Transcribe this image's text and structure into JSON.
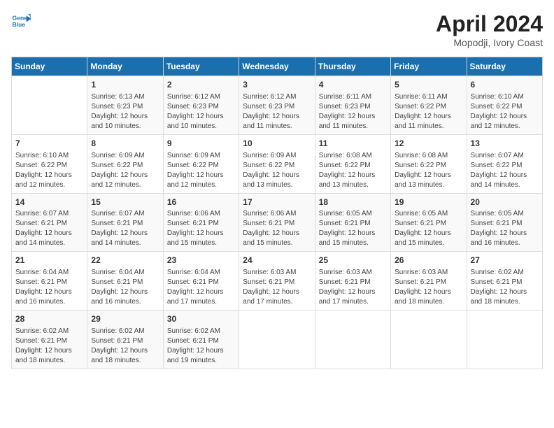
{
  "header": {
    "logo_line1": "General",
    "logo_line2": "Blue",
    "title": "April 2024",
    "subtitle": "Mopodji, Ivory Coast"
  },
  "weekdays": [
    "Sunday",
    "Monday",
    "Tuesday",
    "Wednesday",
    "Thursday",
    "Friday",
    "Saturday"
  ],
  "weeks": [
    [
      {
        "day": "",
        "info": ""
      },
      {
        "day": "1",
        "info": "Sunrise: 6:13 AM\nSunset: 6:23 PM\nDaylight: 12 hours\nand 10 minutes."
      },
      {
        "day": "2",
        "info": "Sunrise: 6:12 AM\nSunset: 6:23 PM\nDaylight: 12 hours\nand 10 minutes."
      },
      {
        "day": "3",
        "info": "Sunrise: 6:12 AM\nSunset: 6:23 PM\nDaylight: 12 hours\nand 11 minutes."
      },
      {
        "day": "4",
        "info": "Sunrise: 6:11 AM\nSunset: 6:23 PM\nDaylight: 12 hours\nand 11 minutes."
      },
      {
        "day": "5",
        "info": "Sunrise: 6:11 AM\nSunset: 6:22 PM\nDaylight: 12 hours\nand 11 minutes."
      },
      {
        "day": "6",
        "info": "Sunrise: 6:10 AM\nSunset: 6:22 PM\nDaylight: 12 hours\nand 12 minutes."
      }
    ],
    [
      {
        "day": "7",
        "info": "Sunrise: 6:10 AM\nSunset: 6:22 PM\nDaylight: 12 hours\nand 12 minutes."
      },
      {
        "day": "8",
        "info": "Sunrise: 6:09 AM\nSunset: 6:22 PM\nDaylight: 12 hours\nand 12 minutes."
      },
      {
        "day": "9",
        "info": "Sunrise: 6:09 AM\nSunset: 6:22 PM\nDaylight: 12 hours\nand 12 minutes."
      },
      {
        "day": "10",
        "info": "Sunrise: 6:09 AM\nSunset: 6:22 PM\nDaylight: 12 hours\nand 13 minutes."
      },
      {
        "day": "11",
        "info": "Sunrise: 6:08 AM\nSunset: 6:22 PM\nDaylight: 12 hours\nand 13 minutes."
      },
      {
        "day": "12",
        "info": "Sunrise: 6:08 AM\nSunset: 6:22 PM\nDaylight: 12 hours\nand 13 minutes."
      },
      {
        "day": "13",
        "info": "Sunrise: 6:07 AM\nSunset: 6:22 PM\nDaylight: 12 hours\nand 14 minutes."
      }
    ],
    [
      {
        "day": "14",
        "info": "Sunrise: 6:07 AM\nSunset: 6:21 PM\nDaylight: 12 hours\nand 14 minutes."
      },
      {
        "day": "15",
        "info": "Sunrise: 6:07 AM\nSunset: 6:21 PM\nDaylight: 12 hours\nand 14 minutes."
      },
      {
        "day": "16",
        "info": "Sunrise: 6:06 AM\nSunset: 6:21 PM\nDaylight: 12 hours\nand 15 minutes."
      },
      {
        "day": "17",
        "info": "Sunrise: 6:06 AM\nSunset: 6:21 PM\nDaylight: 12 hours\nand 15 minutes."
      },
      {
        "day": "18",
        "info": "Sunrise: 6:05 AM\nSunset: 6:21 PM\nDaylight: 12 hours\nand 15 minutes."
      },
      {
        "day": "19",
        "info": "Sunrise: 6:05 AM\nSunset: 6:21 PM\nDaylight: 12 hours\nand 15 minutes."
      },
      {
        "day": "20",
        "info": "Sunrise: 6:05 AM\nSunset: 6:21 PM\nDaylight: 12 hours\nand 16 minutes."
      }
    ],
    [
      {
        "day": "21",
        "info": "Sunrise: 6:04 AM\nSunset: 6:21 PM\nDaylight: 12 hours\nand 16 minutes."
      },
      {
        "day": "22",
        "info": "Sunrise: 6:04 AM\nSunset: 6:21 PM\nDaylight: 12 hours\nand 16 minutes."
      },
      {
        "day": "23",
        "info": "Sunrise: 6:04 AM\nSunset: 6:21 PM\nDaylight: 12 hours\nand 17 minutes."
      },
      {
        "day": "24",
        "info": "Sunrise: 6:03 AM\nSunset: 6:21 PM\nDaylight: 12 hours\nand 17 minutes."
      },
      {
        "day": "25",
        "info": "Sunrise: 6:03 AM\nSunset: 6:21 PM\nDaylight: 12 hours\nand 17 minutes."
      },
      {
        "day": "26",
        "info": "Sunrise: 6:03 AM\nSunset: 6:21 PM\nDaylight: 12 hours\nand 18 minutes."
      },
      {
        "day": "27",
        "info": "Sunrise: 6:02 AM\nSunset: 6:21 PM\nDaylight: 12 hours\nand 18 minutes."
      }
    ],
    [
      {
        "day": "28",
        "info": "Sunrise: 6:02 AM\nSunset: 6:21 PM\nDaylight: 12 hours\nand 18 minutes."
      },
      {
        "day": "29",
        "info": "Sunrise: 6:02 AM\nSunset: 6:21 PM\nDaylight: 12 hours\nand 18 minutes."
      },
      {
        "day": "30",
        "info": "Sunrise: 6:02 AM\nSunset: 6:21 PM\nDaylight: 12 hours\nand 19 minutes."
      },
      {
        "day": "",
        "info": ""
      },
      {
        "day": "",
        "info": ""
      },
      {
        "day": "",
        "info": ""
      },
      {
        "day": "",
        "info": ""
      }
    ]
  ]
}
